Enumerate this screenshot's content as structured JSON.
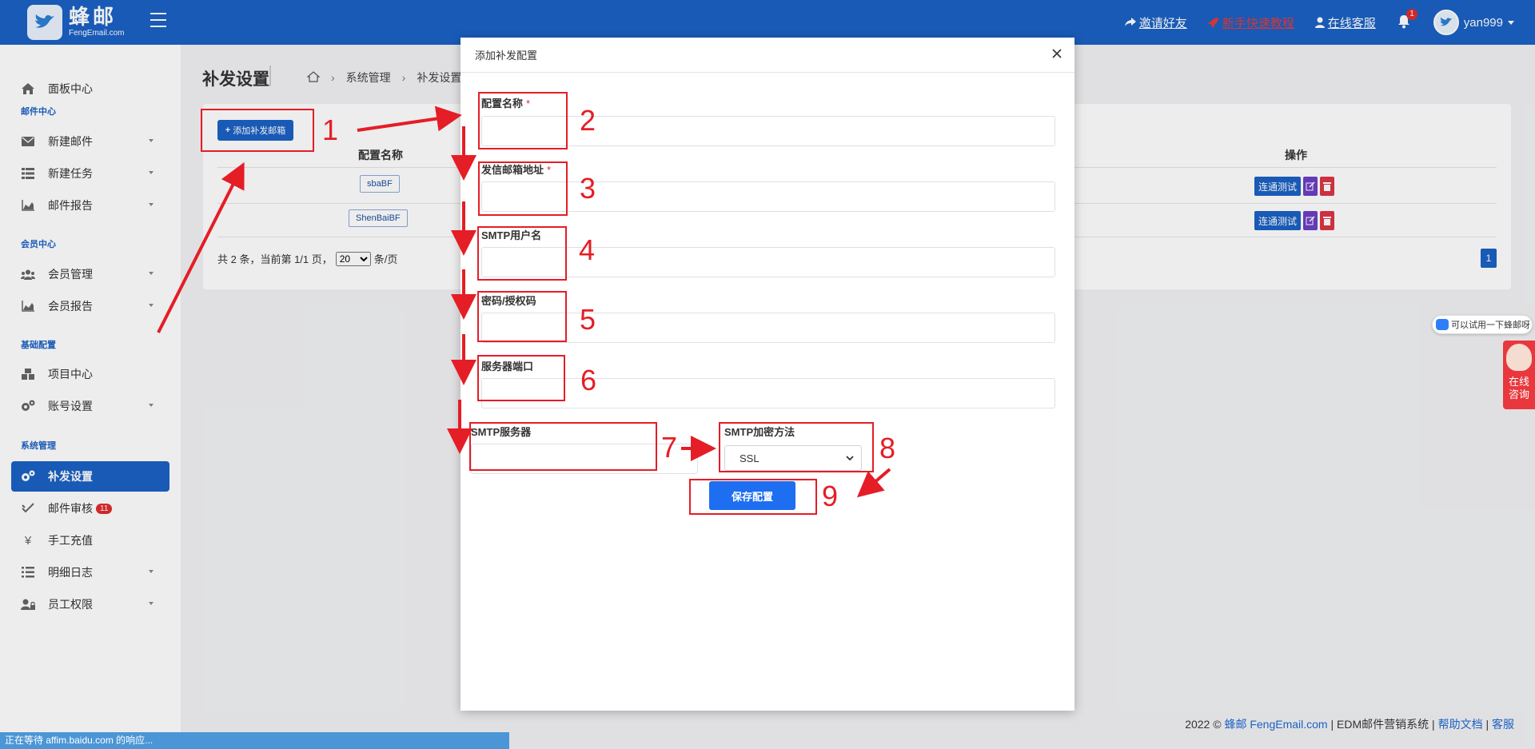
{
  "topbar": {
    "logo_cn": "蜂邮",
    "logo_en": "FengEmail.com",
    "invite": "邀请好友",
    "tutorial": "新手快速教程",
    "support": "在线客服",
    "bell_count": "1",
    "username": "yan999"
  },
  "sidebar": {
    "dashboard": "面板中心",
    "sec_mail": "邮件中心",
    "new_mail": "新建邮件",
    "new_task": "新建任务",
    "mail_report": "邮件报告",
    "sec_member": "会员中心",
    "member_mgmt": "会员管理",
    "member_report": "会员报告",
    "sec_base": "基础配置",
    "project_center": "项目中心",
    "account_settings": "账号设置",
    "sec_system": "系统管理",
    "resend_settings": "补发设置",
    "mail_review": "邮件审核",
    "mail_review_count": "11",
    "manual_recharge": "手工充值",
    "detail_log": "明细日志",
    "staff_perm": "员工权限"
  },
  "main": {
    "title": "补发设置",
    "breadcrumb_1": "系统管理",
    "breadcrumb_2": "补发设置",
    "add_button": "添加补发邮箱",
    "col_name": "配置名称",
    "col_ops": "操作",
    "rows": [
      {
        "name": "sbaBF"
      },
      {
        "name": "ShenBaiBF"
      }
    ],
    "op_test": "连通测试",
    "pager_prefix": "共 2 条，当前第 1/1 页，",
    "page_size": "20",
    "pager_suffix": "条/页",
    "page_num": "1"
  },
  "modal": {
    "title": "添加补发配置",
    "config_name": "配置名称",
    "sender_email": "发信邮箱地址",
    "smtp_user": "SMTP用户名",
    "password": "密码/授权码",
    "server_port": "服务器端口",
    "smtp_server": "SMTP服务器",
    "smtp_encrypt": "SMTP加密方法",
    "encrypt_value": "SSL",
    "save": "保存配置",
    "required": "*"
  },
  "annotations": [
    "1",
    "2",
    "3",
    "4",
    "5",
    "6",
    "7",
    "8",
    "9"
  ],
  "footer": {
    "copyright": "2022 ©",
    "brand": "蜂邮 FengEmail.com",
    "system": "EDM邮件营销系统",
    "help": "帮助文档",
    "support": "客服",
    "sep": "|"
  },
  "statusbar": "正在等待 affim.baidu.com 的响应...",
  "widgets": {
    "try_text": "可以试用一下蜂邮呀",
    "consult_1": "在线",
    "consult_2": "咨询"
  },
  "colors": {
    "primary": "#1a61c4",
    "annotation": "#e51d26",
    "danger": "#dc3545",
    "edit": "#6c3fc4",
    "save": "#1d6ef0"
  }
}
